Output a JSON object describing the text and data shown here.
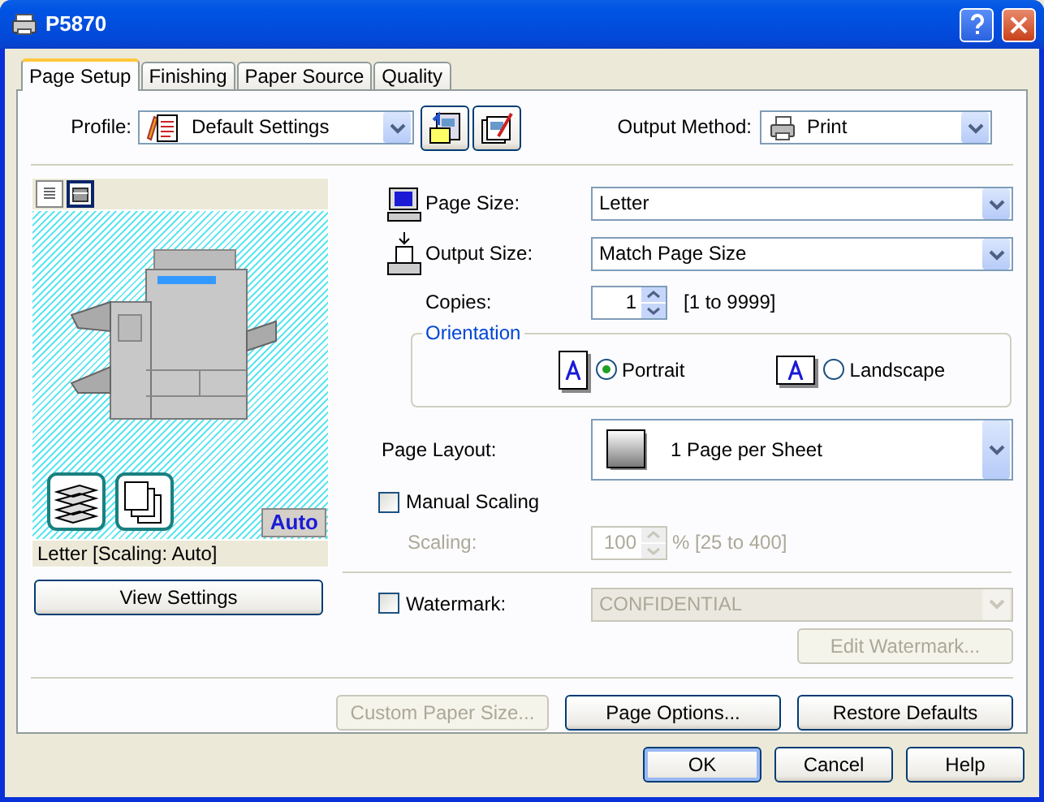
{
  "window": {
    "title": "P5870"
  },
  "tabs": [
    {
      "label": "Page Setup",
      "selected": true
    },
    {
      "label": "Finishing",
      "selected": false
    },
    {
      "label": "Paper Source",
      "selected": false
    },
    {
      "label": "Quality",
      "selected": false
    }
  ],
  "profile": {
    "label": "Profile:",
    "value": "Default Settings"
  },
  "output_method": {
    "label": "Output Method:",
    "value": "Print"
  },
  "preview": {
    "view_modes": [
      {
        "selected": false
      },
      {
        "selected": true
      }
    ],
    "badge": "Auto",
    "caption": "Letter [Scaling: Auto]",
    "button": "View Settings"
  },
  "page_size": {
    "label": "Page Size:",
    "value": "Letter"
  },
  "output_size": {
    "label": "Output Size:",
    "value": "Match Page Size"
  },
  "copies": {
    "label": "Copies:",
    "value": "1",
    "range": "[1 to 9999]"
  },
  "orientation": {
    "legend": "Orientation",
    "options": [
      {
        "label": "Portrait",
        "selected": true
      },
      {
        "label": "Landscape",
        "selected": false
      }
    ]
  },
  "page_layout": {
    "label": "Page Layout:",
    "value": "1 Page per Sheet"
  },
  "manual_scaling": {
    "label": "Manual Scaling",
    "checked": false
  },
  "scaling": {
    "label": "Scaling:",
    "value": "100",
    "range": "% [25 to 400]",
    "disabled": true
  },
  "watermark": {
    "label": "Watermark:",
    "checked": false,
    "value": "CONFIDENTIAL",
    "disabled": true
  },
  "edit_watermark": {
    "label": "Edit Watermark...",
    "disabled": true
  },
  "page_buttons": [
    {
      "label": "Custom Paper Size...",
      "disabled": true
    },
    {
      "label": "Page Options...",
      "disabled": false
    },
    {
      "label": "Restore Defaults",
      "disabled": false
    }
  ],
  "dialog_buttons": [
    {
      "label": "OK",
      "default": true
    },
    {
      "label": "Cancel",
      "default": false
    },
    {
      "label": "Help",
      "default": false
    }
  ]
}
